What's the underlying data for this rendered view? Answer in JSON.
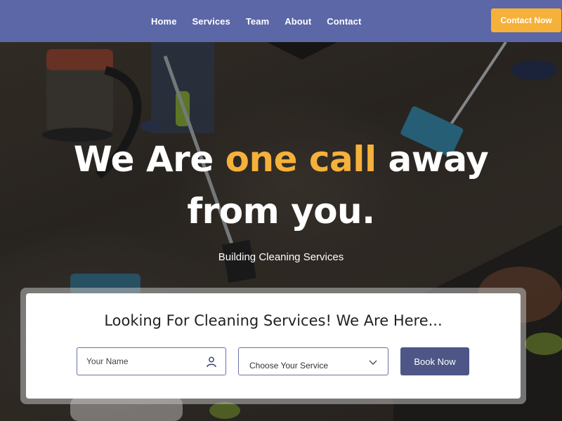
{
  "nav": {
    "links": [
      "Home",
      "Services",
      "Team",
      "About",
      "Contact"
    ],
    "cta_label": "Contact Now"
  },
  "hero": {
    "title_part1": "We Are ",
    "title_accent": "one call",
    "title_part2": " away",
    "title_line2": "from you.",
    "subtitle": "Building Cleaning Services"
  },
  "booking": {
    "heading": "Looking For Cleaning Services! We Are Here...",
    "name_placeholder": "Your Name",
    "name_value": "",
    "service_selected": "Choose Your Service",
    "submit_label": "Book Now"
  },
  "colors": {
    "nav_bg": "#5b67a6",
    "accent": "#f6b13a",
    "button_bg": "#4d5686"
  },
  "icons": {
    "name_field": "user-icon",
    "service_field": "chevron-down-icon"
  }
}
